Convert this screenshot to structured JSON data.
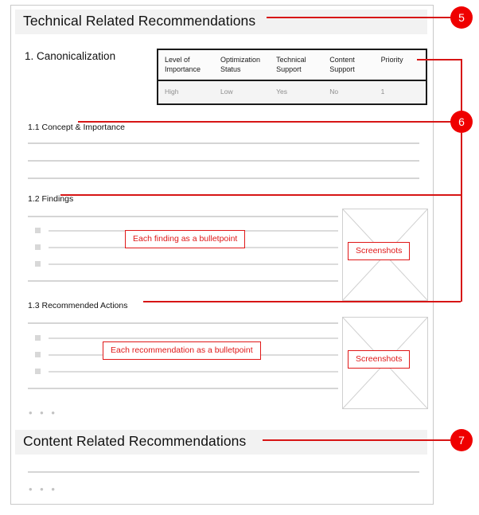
{
  "document": {
    "sections": [
      {
        "id": "technical",
        "title": "Technical Related Recommendations",
        "callout": "5"
      },
      {
        "id": "content",
        "title": "Content Related Recommendations",
        "callout": "7"
      }
    ],
    "topic": {
      "number_title": "1. Canonicalization",
      "subsections": [
        {
          "id": "concept",
          "label": "1.1 Concept & Importance"
        },
        {
          "id": "findings",
          "label": "1.2 Findings"
        },
        {
          "id": "actions",
          "label": "1.3 Recommended Actions"
        }
      ]
    },
    "spec_table": {
      "callout": "6",
      "headers": [
        "Level of Importance",
        "Optimization Status",
        "Technical Support",
        "Content Support",
        "Priority"
      ],
      "rows": [
        [
          "High",
          "Low",
          "Yes",
          "No",
          "1"
        ]
      ]
    },
    "annotations": [
      {
        "id": "finding-bullet",
        "text": "Each finding as a bulletpoint"
      },
      {
        "id": "findings-shots",
        "text": "Screenshots"
      },
      {
        "id": "recommendation-bullet",
        "text": "Each recommendation as a bulletpoint"
      },
      {
        "id": "actions-shots",
        "text": "Screenshots"
      }
    ],
    "continuation": {
      "findings_more": "• • •",
      "content_more": "• • •"
    },
    "colors": {
      "callout_red": "#ef0000",
      "annotation_red": "#e01818",
      "leader_red": "#d71515",
      "band_gray": "#f2f2f2",
      "rule_gray": "#d5d5d5",
      "page_border": "#c9c9c9"
    }
  }
}
